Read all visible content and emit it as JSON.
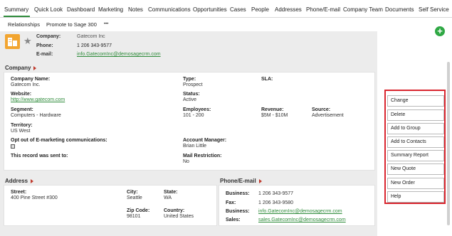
{
  "tabs": [
    "Summary",
    "Quick Look",
    "Dashboard",
    "Marketing",
    "Notes",
    "Communications",
    "Opportunities",
    "Cases",
    "People",
    "Addresses",
    "Phone/E-mail",
    "Company Team",
    "Documents",
    "Self Service"
  ],
  "subrow": {
    "relationships": "Relationships",
    "promote": "Promote to Sage 300",
    "more": "•••"
  },
  "header": {
    "company_label": "Company:",
    "company_value": "Gatecom Inc",
    "phone_label": "Phone:",
    "phone_value": "1 206 343-9577",
    "email_label": "E-mail:",
    "email_value": "info.GatecomInc@demosagecrm.com"
  },
  "company_section": {
    "title": "Company",
    "company_name_label": "Company Name:",
    "company_name": "Gatecom Inc.",
    "type_label": "Type:",
    "type": "Prospect",
    "sla_label": "SLA:",
    "website_label": "Website:",
    "website": "http://www.gatecom.com",
    "status_label": "Status:",
    "status": "Active",
    "segment_label": "Segment:",
    "segment": "Computers - Hardware",
    "employees_label": "Employees:",
    "employees": "101 - 200",
    "revenue_label": "Revenue:",
    "revenue": "$5M - $10M",
    "source_label": "Source:",
    "source": "Advertisement",
    "territory_label": "Territory:",
    "territory": "US West",
    "optout_label": "Opt out of E-marketing communications:",
    "account_manager_label": "Account Manager:",
    "account_manager": "Brian Little",
    "sent_label": "This record was sent to:",
    "mail_restriction_label": "Mail Restriction:",
    "mail_restriction": "No"
  },
  "address_section": {
    "title": "Address",
    "street_label": "Street:",
    "street": "400 Pine Street #300",
    "city_label": "City:",
    "city": "Seattle",
    "state_label": "State:",
    "state": "WA",
    "zip_label": "Zip Code:",
    "zip": "98101",
    "country_label": "Country:",
    "country": "United States"
  },
  "phone_section": {
    "title": "Phone/E-mail",
    "business_label": "Business:",
    "business_phone": "1 206 343-9577",
    "fax_label": "Fax:",
    "fax": "1 206 343-9580",
    "business_email_label": "Business:",
    "business_email": "info.GatecomInc@demosagecrm.com",
    "sales_label": "Sales:",
    "sales_email": "sales.GatecomInc@demosagecrm.com"
  },
  "actions": [
    "Change",
    "Delete",
    "Add to Group",
    "Add to Contacts",
    "Summary Report",
    "New Quote",
    "New Order",
    "Help"
  ],
  "colors": {
    "accent": "#2e8b3a",
    "highlight": "#d9262f",
    "building": "#f2a530",
    "caret": "#c0392b"
  }
}
